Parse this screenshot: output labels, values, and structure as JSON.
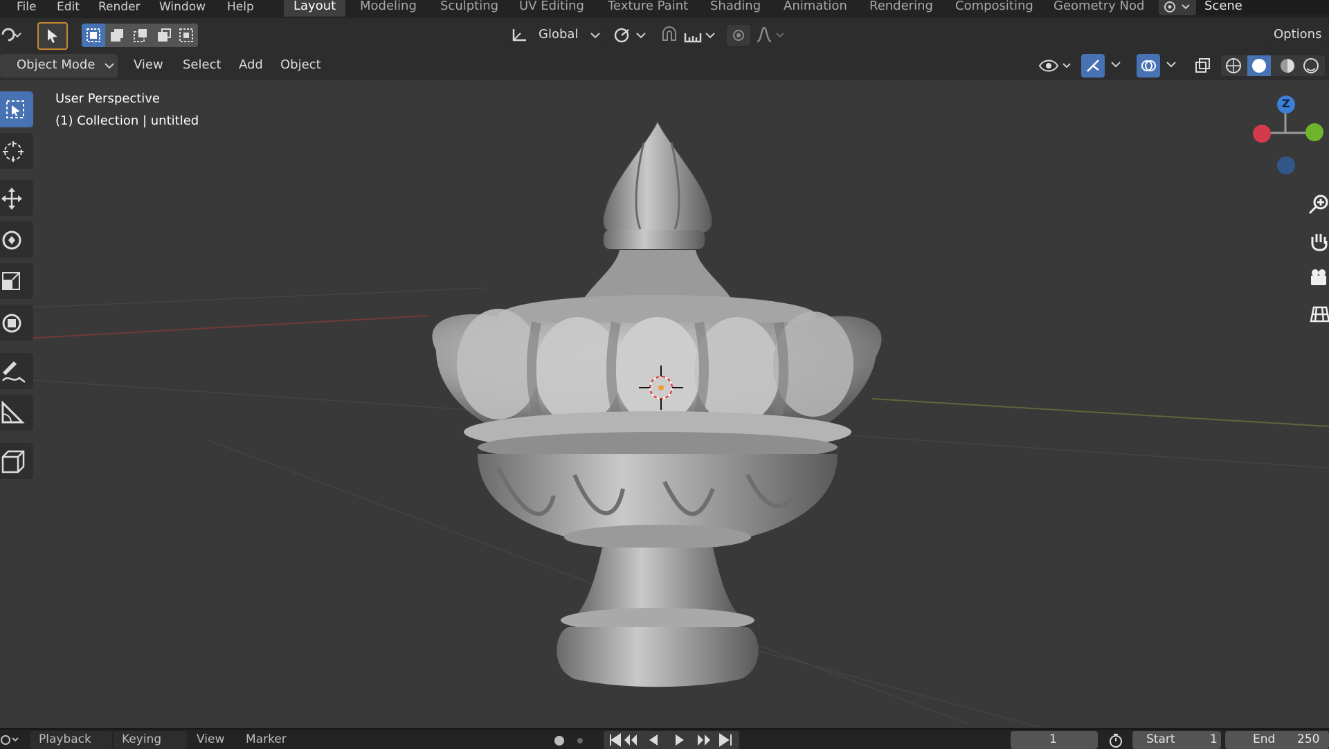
{
  "menu": [
    "File",
    "Edit",
    "Render",
    "Window",
    "Help"
  ],
  "workspaces": [
    "Layout",
    "Modeling",
    "Sculpting",
    "UV Editing",
    "Texture Paint",
    "Shading",
    "Animation",
    "Rendering",
    "Compositing",
    "Geometry Nod"
  ],
  "active_workspace": "Layout",
  "scene_name": "Scene",
  "toolbar": {
    "orientation": "Global",
    "options_label": "Options"
  },
  "header": {
    "mode": "Object Mode",
    "view": "View",
    "select": "Select",
    "add": "Add",
    "object": "Object"
  },
  "viewport": {
    "perspective": "User Perspective",
    "collection": "(1) Collection | untitled"
  },
  "gizmo": {
    "z_label": "Z",
    "colors": {
      "x": "#d33b4c",
      "y": "#6fb52b",
      "z": "#3c7fd6"
    }
  },
  "timeline": {
    "playback": "Playback",
    "keying": "Keying",
    "view": "View",
    "marker": "Marker",
    "current_frame": "1",
    "start_label": "Start",
    "start_value": "1",
    "end_label": "End",
    "end_value": "250"
  },
  "colors": {
    "active_tool": "#4772b3",
    "viewport_bg": "#393939"
  }
}
